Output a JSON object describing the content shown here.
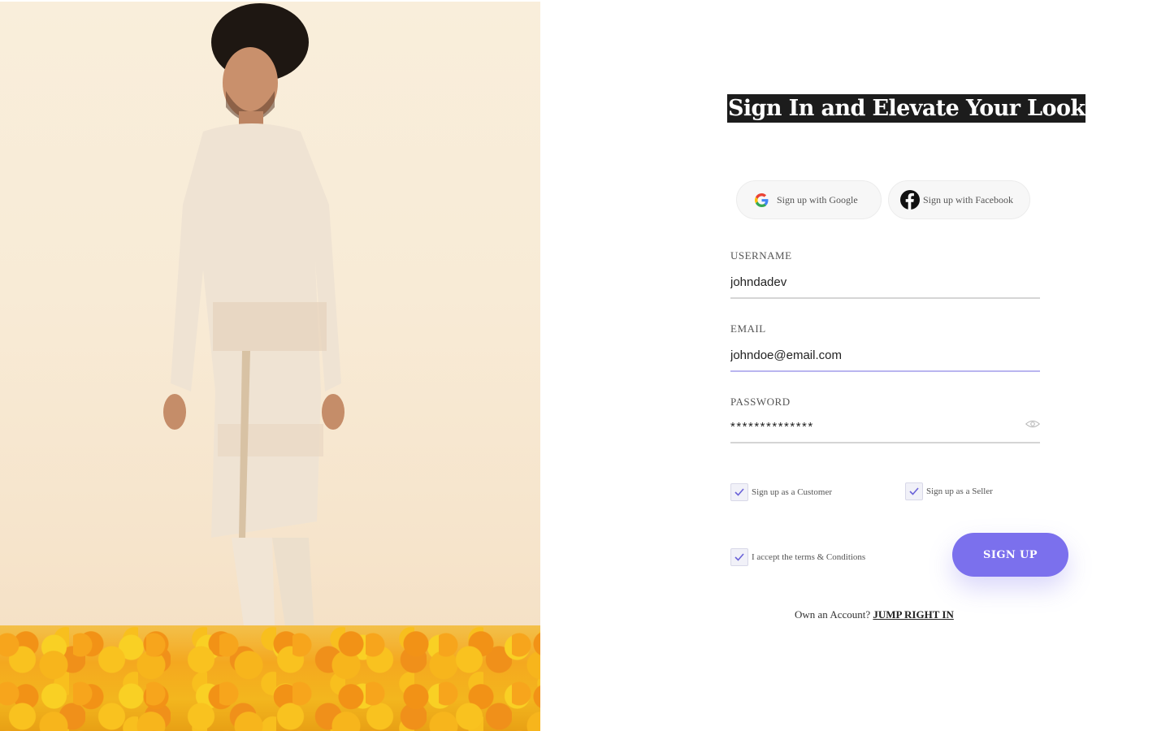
{
  "heading": "Sign In and Elevate Your Look",
  "social": {
    "google_label": "Sign up with Google",
    "facebook_label": "Sign up with Facebook"
  },
  "form": {
    "username": {
      "label": "USERNAME",
      "value": "johndadev"
    },
    "email": {
      "label": "EMAIL",
      "value": "johndoe@email.com"
    },
    "password": {
      "label": "PASSWORD",
      "value": "**************"
    }
  },
  "roles": {
    "customer_label": "Sign up as a Customer",
    "customer_checked": true,
    "seller_label": "Sign up as a Seller",
    "seller_checked": true
  },
  "terms": {
    "label": "I accept the terms & Conditions",
    "checked": true
  },
  "signup_button": "SIGN UP",
  "login_prompt": {
    "text": "Own an Account?",
    "link": "JUMP RIGHT IN"
  },
  "colors": {
    "accent": "#7b70ed",
    "heading_bg": "#1c1c1c"
  },
  "icons": [
    "google-icon",
    "facebook-icon",
    "eye-icon",
    "checkmark-icon"
  ]
}
